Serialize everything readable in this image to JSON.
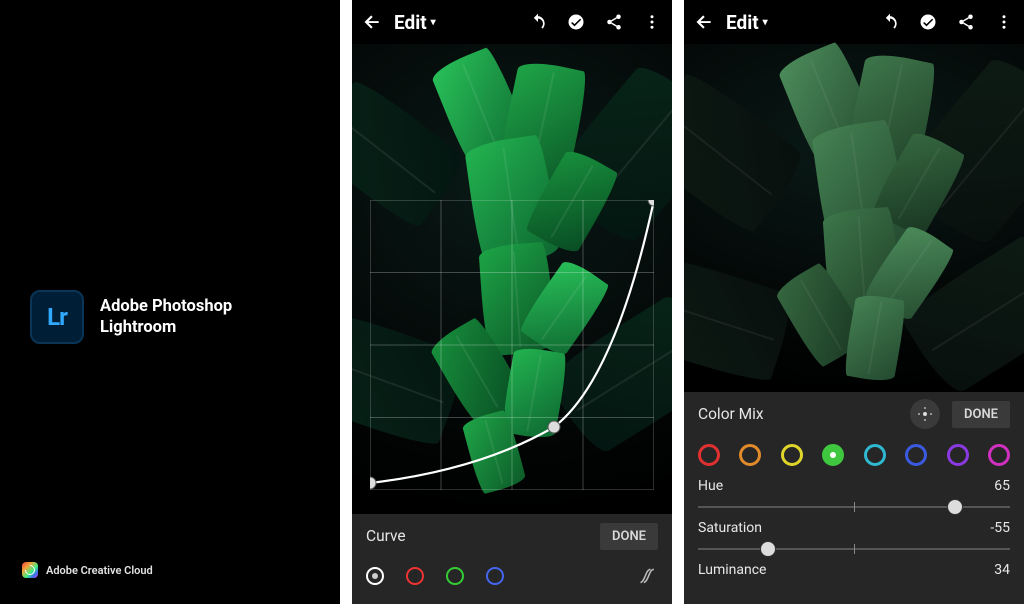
{
  "splash": {
    "lr_text": "Lr",
    "title_line1": "Adobe Photoshop",
    "title_line2": "Lightroom",
    "cc_label": "Adobe Creative Cloud"
  },
  "header": {
    "title": "Edit",
    "caret": "▾"
  },
  "curve_panel": {
    "label": "Curve",
    "done": "DONE",
    "channels": [
      "white",
      "red",
      "green",
      "blue"
    ],
    "chart_data": {
      "type": "line",
      "xlim": [
        0,
        255
      ],
      "ylim": [
        0,
        255
      ],
      "points": [
        {
          "x": 0,
          "y": 6
        },
        {
          "x": 165,
          "y": 55
        },
        {
          "x": 255,
          "y": 255
        }
      ]
    }
  },
  "colormix": {
    "label": "Color Mix",
    "done": "DONE",
    "swatches": [
      {
        "name": "red",
        "hex": "#e03030"
      },
      {
        "name": "orange",
        "hex": "#e08a2a"
      },
      {
        "name": "yellow",
        "hex": "#e0d52a"
      },
      {
        "name": "green",
        "hex": "#3fc83f",
        "selected": true
      },
      {
        "name": "aqua",
        "hex": "#2fb8d0"
      },
      {
        "name": "blue",
        "hex": "#3a5ae0"
      },
      {
        "name": "purple",
        "hex": "#8a3ae0"
      },
      {
        "name": "magenta",
        "hex": "#d030c0"
      }
    ],
    "sliders": {
      "hue": {
        "label": "Hue",
        "value": 65,
        "min": -100,
        "max": 100
      },
      "saturation": {
        "label": "Saturation",
        "value": -55,
        "min": -100,
        "max": 100
      },
      "luminance": {
        "label": "Luminance",
        "value": 34,
        "min": -100,
        "max": 100
      }
    }
  }
}
